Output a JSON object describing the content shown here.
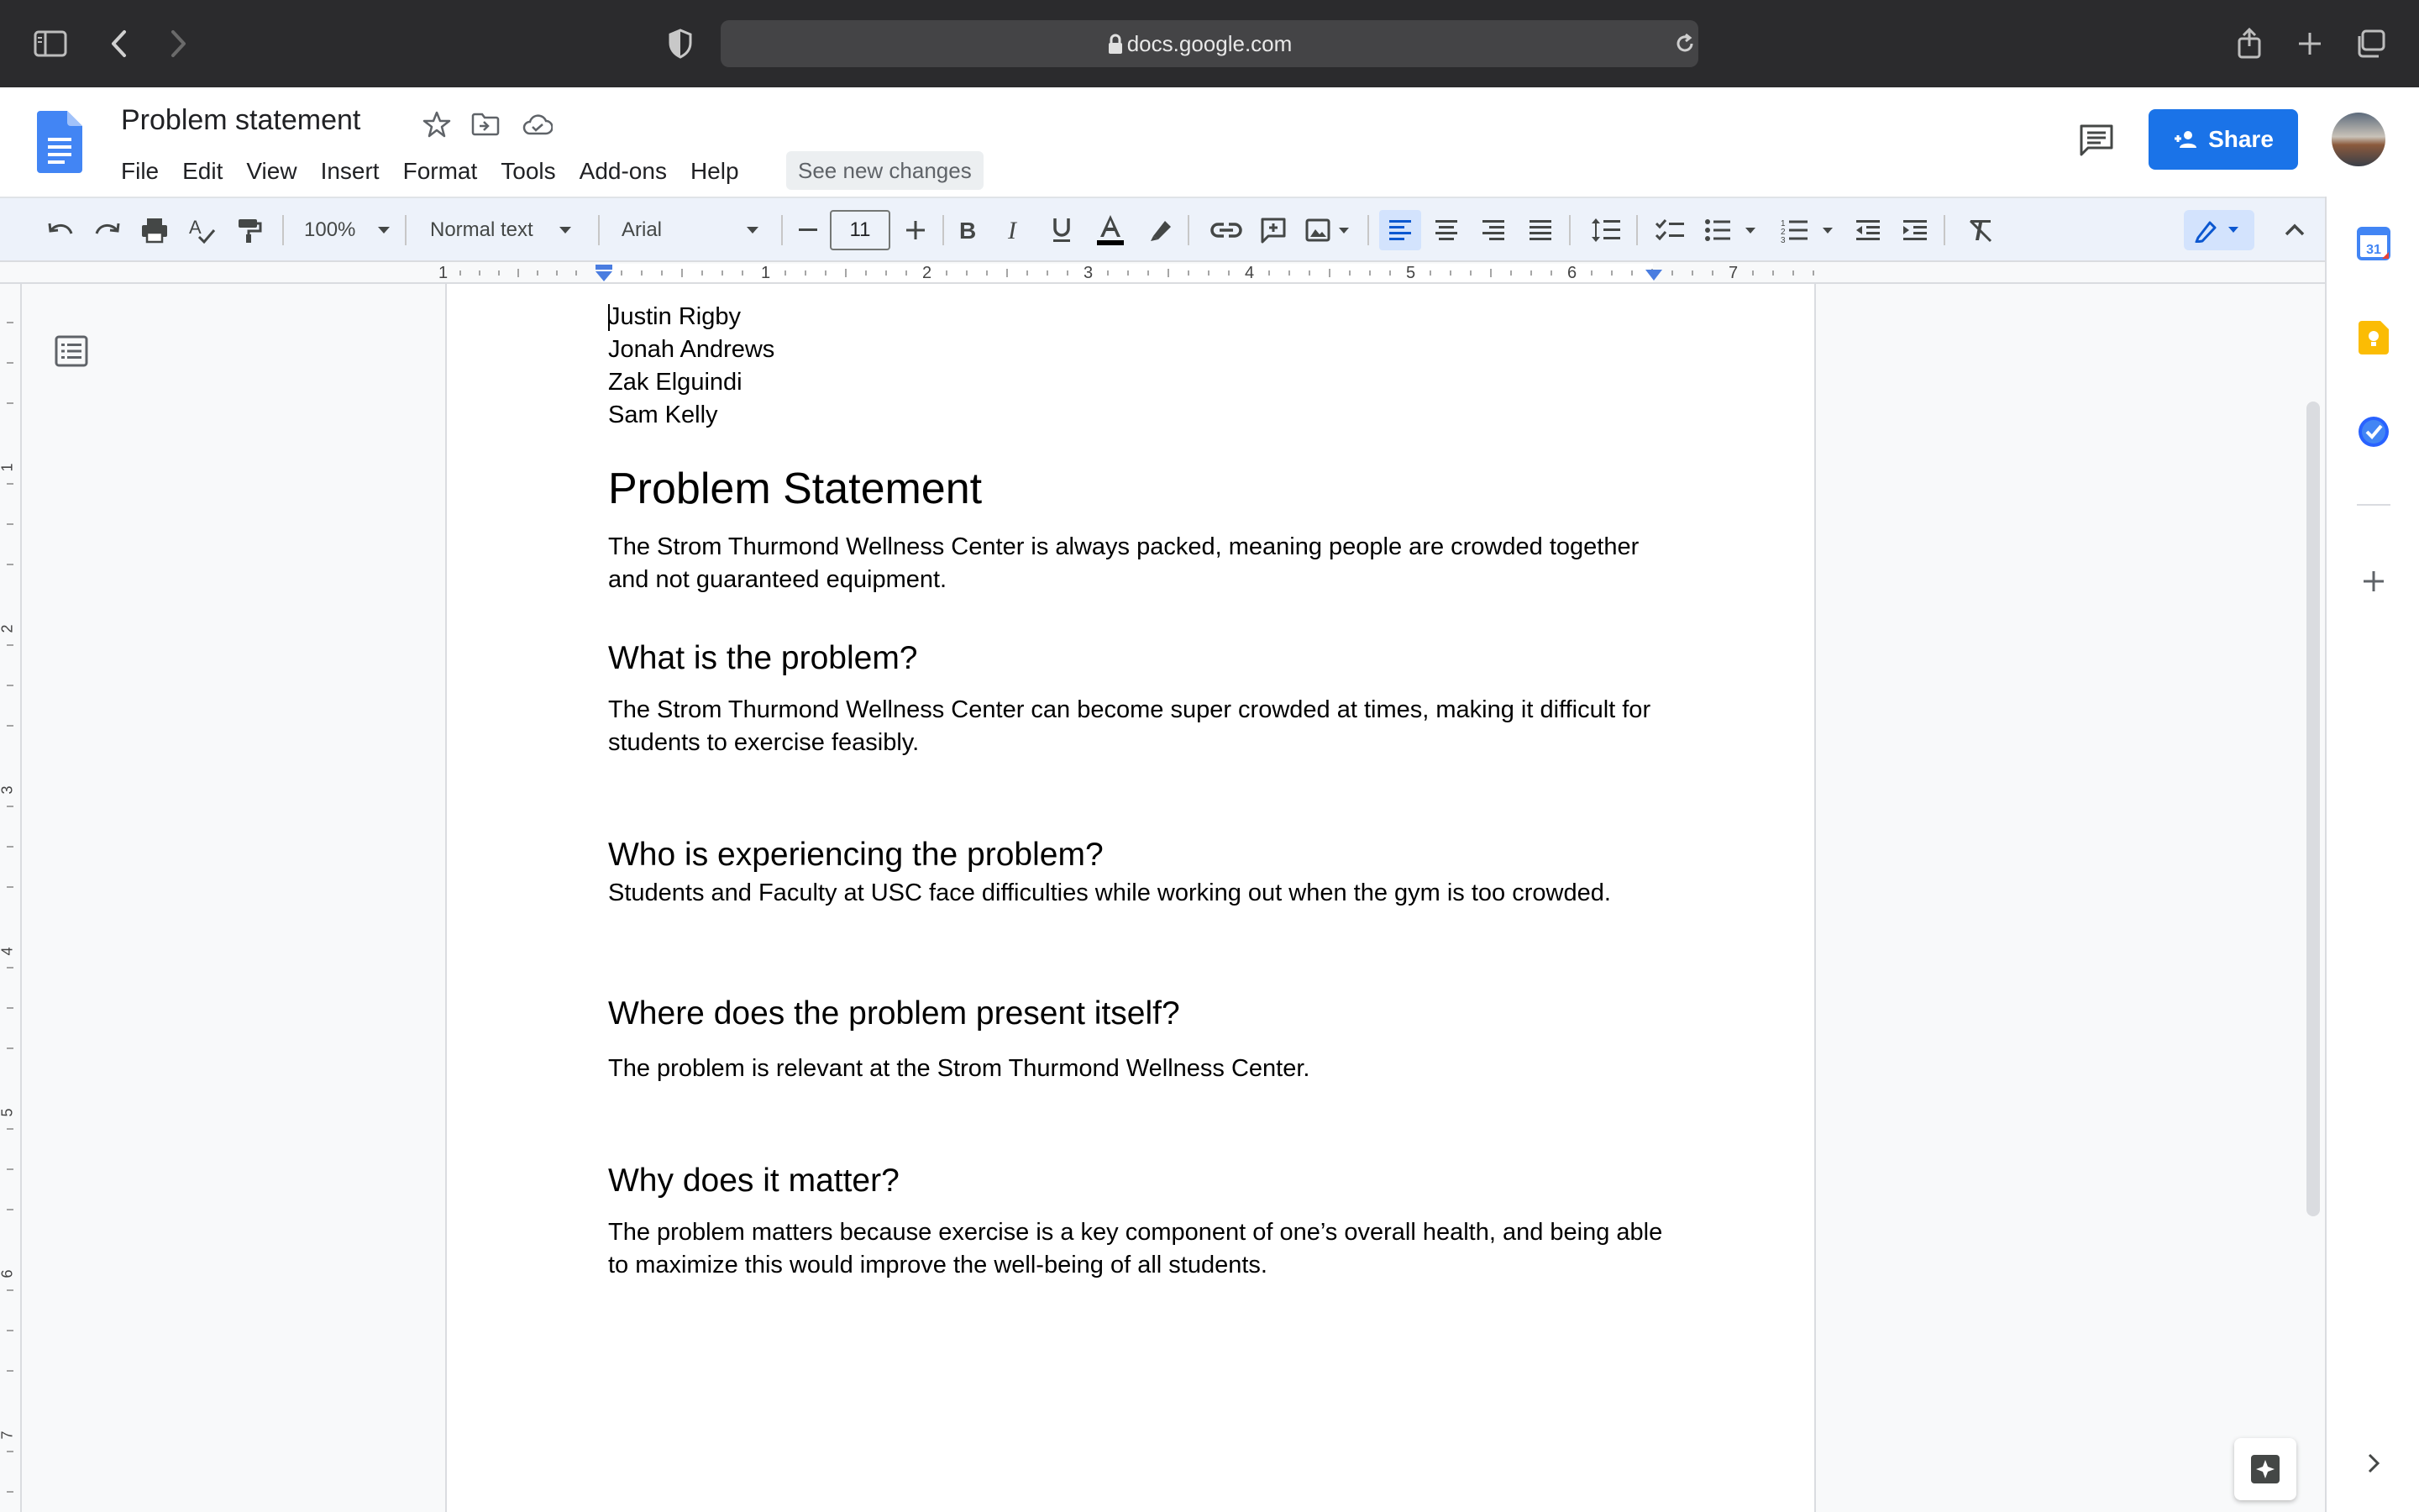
{
  "browser": {
    "url": "docs.google.com",
    "icons": [
      "sidebar-icon",
      "back-icon",
      "forward-icon",
      "shield-icon",
      "lock-icon",
      "reload-icon",
      "share-icon",
      "plus-icon",
      "tabs-icon"
    ]
  },
  "header": {
    "title": "Problem statement",
    "menu": [
      "File",
      "Edit",
      "View",
      "Insert",
      "Format",
      "Tools",
      "Add-ons",
      "Help"
    ],
    "see_new_changes": "See new changes",
    "share_label": "Share"
  },
  "toolbar": {
    "zoom": "100%",
    "style": "Normal text",
    "font": "Arial",
    "font_size": "11"
  },
  "ruler": {
    "marks": [
      "1",
      "1",
      "2",
      "3",
      "4",
      "5",
      "6",
      "7"
    ],
    "vertical_marks": [
      "1",
      "2",
      "3",
      "4",
      "5",
      "6",
      "7"
    ]
  },
  "document": {
    "authors": [
      "Justin Rigby",
      "Jonah Andrews",
      "Zak Elguindi",
      "Sam Kelly"
    ],
    "title": "Problem Statement",
    "intro": "The Strom Thurmond Wellness Center is always packed, meaning people are crowded together and not guaranteed equipment.",
    "sections": [
      {
        "heading": "What is the problem?",
        "body": "The Strom Thurmond Wellness Center can become super crowded at times, making it difficult for students to exercise feasibly."
      },
      {
        "heading": "Who is experiencing the problem?",
        "body": "Students and Faculty at USC face difficulties while working out when the gym is too crowded."
      },
      {
        "heading": "Where does the problem present itself?",
        "body": "The problem is relevant at the Strom Thurmond Wellness Center."
      },
      {
        "heading": "Why does it matter?",
        "body": "The problem matters because exercise is a key component of one’s overall health, and being able to maximize this would improve the well-being of all students."
      }
    ]
  },
  "side_panel": {
    "calendar_day": "31"
  },
  "colors": {
    "accent": "#1a73e8",
    "docs_blue": "#4285f4",
    "keep_yellow": "#fbbc04",
    "toolbar_bg": "#edf2fa"
  }
}
